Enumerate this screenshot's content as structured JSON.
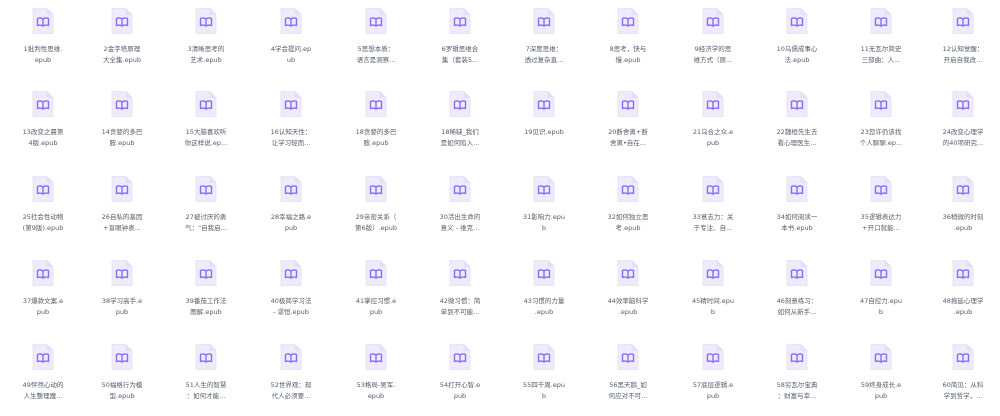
{
  "view": "file-grid",
  "icon": {
    "name": "book-file-icon",
    "fill": "#eeebfb",
    "stroke": "#8b6cf2"
  },
  "files": [
    [
      "1批判性思维.\nepub",
      "2金字塔原理\n大全集.epub",
      "3清晰思考的\n艺术.epub",
      "4学会提问.ep\nub",
      "5思想本质：\n语言是洞察...",
      "6罗辑思维合\n集（套装5...",
      "7深度思维：\n透过复杂直...",
      "8思考，快与\n慢.epub",
      "9经济学的思\n维方式（原...",
      "10乌儒成事心\n法.epub",
      "11无瓦尔简史\n三部曲：人...",
      "12认知觉醒：\n开启自我改..."
    ],
    [
      "13改变之晨第\n4版.epub",
      "14贪婪的多巴\n胺.epub",
      "15大脑喜欢听\n你这样说.ep...",
      "16认知天性：\n让学习轻而...",
      "18贪婪的多巴\n胺.epub",
      "18稀缺_我们\n是如何陷入...",
      "19见识.epub",
      "20断舍离+断\n舍离•自在...",
      "21乌合之众.e\npub",
      "22魏桓先生去\n看心理医生...",
      "23您许仍该找\n个人聊聊.ep...",
      "24改变心理学\n的40项研究..."
    ],
    [
      "25社会性动物\n(第9版).epub",
      "26自私的基因\n+盲眼钟表...",
      "27被讨厌的勇\n气：\"自我启...",
      "28幸福之路.e\npub",
      "29亲密关系（\n第6版）.epub",
      "30活出生命的\n意义 - 维克...",
      "31影响力.epu\nb",
      "32如何独立思\n考.epub",
      "33意志力：关\n于专注、自...",
      "34如何阅读一\n本书.epub",
      "35逻辑表达力\n+开口就能...",
      "36稍微的时刻\n.epub"
    ],
    [
      "37爆款文案.e\npub",
      "38学习高手.e\npub",
      "39番茄工作法\n图解.epub",
      "40极简学习法\n- 谬恒.epub",
      "41掌控习惯.e\npub",
      "42微习惯：简\n单到不可能...",
      "43习惯的力量\n.epub",
      "44效率脑科学\n.epub",
      "45精时间.epu\nb",
      "46刻意练习：\n如何从新手...",
      "47自控力.epu\nb",
      "48拖延心理学\n.epub"
    ],
    [
      "49怦然心动的\n人生整理魔...",
      "50福格行为模\n型.epub",
      "51人生的智慧\n：如何才能...",
      "52世界观：现\n代人必须要...",
      "53格局-吴军.\nepub",
      "54打开心智.e\npub",
      "55四千周.epu\nb",
      "56黑天鹅_如\n何应对不可...",
      "57底层逻辑.e\npub",
      "58穷瓦尔宝典\n：财富与幸...",
      "59终身成长.e\npub",
      "60简见：从科\n学到哲学，..."
    ]
  ]
}
